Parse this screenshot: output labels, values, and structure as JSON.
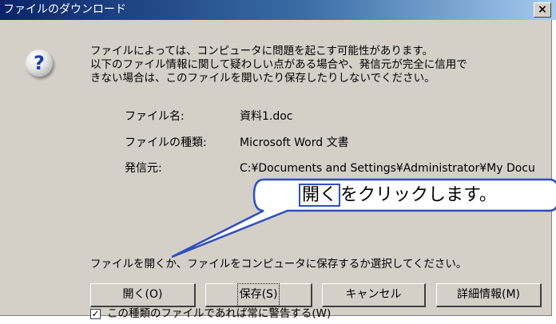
{
  "title": "ファイルのダウンロード",
  "close_label": "×",
  "message_lines": [
    "ファイルによっては、コンピュータに問題を起こす可能性があります。",
    "以下のファイル情報に関して疑わしい点がある場合や、発信元が完全に信用で",
    "きない場合は、このファイルを開いたり保存したりしないでください。"
  ],
  "file_info": {
    "name_label": "ファイル名:",
    "name_value": "資料1.doc",
    "type_label": "ファイルの種類:",
    "type_value": "Microsoft Word 文書",
    "source_label": "発信元:",
    "source_value": "C:¥Documents and Settings¥Administrator¥My Docu"
  },
  "question": "ファイルを開くか、ファイルをコンピュータに保存するか選択してください。",
  "buttons": {
    "open": "開く(O)",
    "save": "保存(S)",
    "cancel": "キャンセル",
    "details": "詳細情報(M)"
  },
  "checkbox": {
    "checked": true,
    "label": "この種類のファイルであれば常に警告する(W)"
  },
  "callout": {
    "highlight": "開く",
    "text": "をクリックします。"
  },
  "colors": {
    "titlebar_start": "#0a246a",
    "dialog_bg": "#d4d0c8",
    "callout_border": "#2f4fbf"
  },
  "icons": {
    "question": "question-mark-icon",
    "close": "close-icon"
  }
}
